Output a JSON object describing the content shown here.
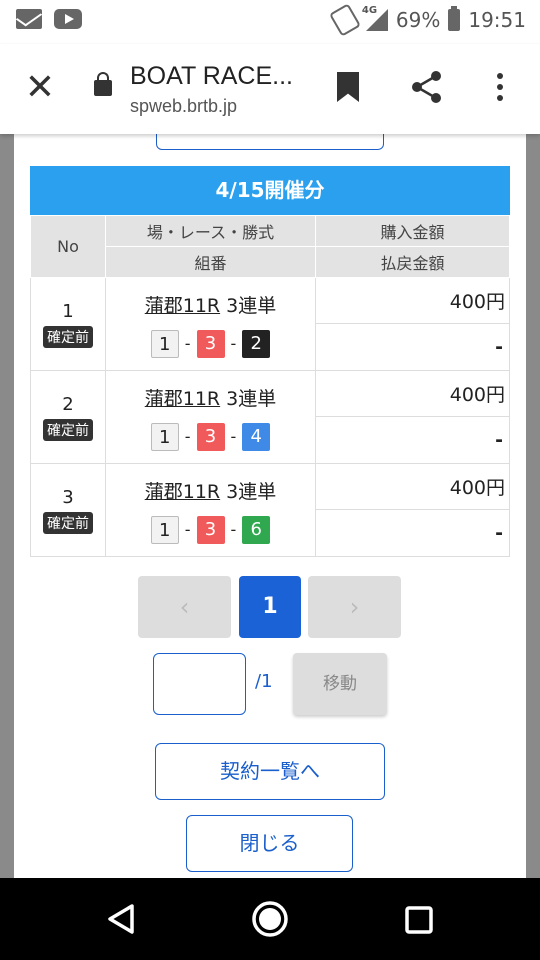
{
  "status_bar": {
    "battery_percent": "69%",
    "time": "19:51",
    "network": "4G",
    "icons": [
      "mail-icon",
      "youtube-icon",
      "phone-signal-icon",
      "signal-icon",
      "battery-icon"
    ]
  },
  "browser": {
    "title": "BOAT RACE...",
    "url": "spweb.brtb.jp",
    "icons": [
      "close-icon",
      "lock-icon",
      "bookmark-icon",
      "share-icon",
      "more-icon"
    ]
  },
  "modal": {
    "date_header": "4/15開催分",
    "table_headers": {
      "no": "No",
      "venue_race_type": "場・レース・勝式",
      "combination": "組番",
      "purchase_amount": "購入金額",
      "payout_amount": "払戻金額"
    },
    "rows": [
      {
        "no": "1",
        "status": "確定前",
        "venue_race": "蒲郡11R",
        "bet_type": "3連単",
        "combo": [
          "1",
          "3",
          "2"
        ],
        "amount": "400円",
        "payout": "-"
      },
      {
        "no": "2",
        "status": "確定前",
        "venue_race": "蒲郡11R",
        "bet_type": "3連単",
        "combo": [
          "1",
          "3",
          "4"
        ],
        "amount": "400円",
        "payout": "-"
      },
      {
        "no": "3",
        "status": "確定前",
        "venue_race": "蒲郡11R",
        "bet_type": "3連単",
        "combo": [
          "1",
          "3",
          "6"
        ],
        "amount": "400円",
        "payout": "-"
      }
    ],
    "combo_separator": "-",
    "pagination": {
      "prev": "‹",
      "current": "1",
      "next": "›",
      "total": "/1",
      "move_label": "移動"
    },
    "buttons": {
      "contract_list": "契約一覧へ",
      "close": "閉じる"
    }
  },
  "colors": {
    "header_blue": "#2ba0ee",
    "primary_blue": "#1a62d6",
    "boat_1": "#f2f2f2",
    "boat_2": "#222222",
    "boat_3": "#f05a5a",
    "boat_4": "#3f8ae6",
    "boat_6": "#2fa84f"
  }
}
